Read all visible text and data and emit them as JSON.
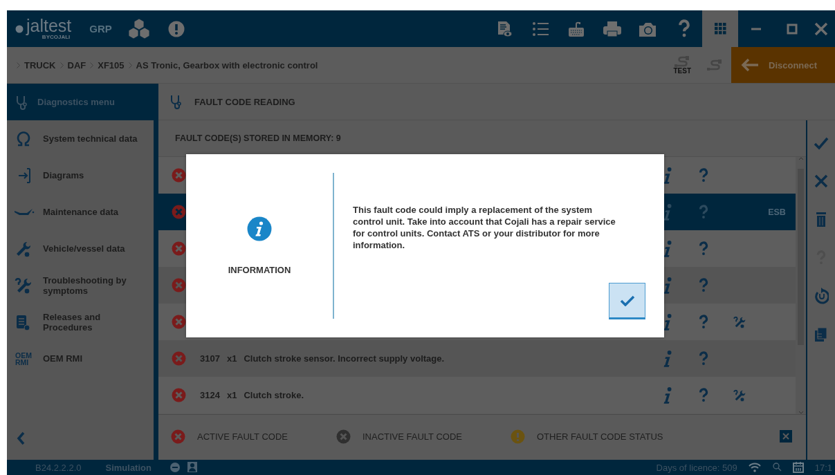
{
  "top_bar": {
    "logo": "**jal**test",
    "logo_sub": "BYCOJALI",
    "mode": "GRP"
  },
  "breadcrumb": [
    {
      "label": "TRUCK"
    },
    {
      "label": "DAF"
    },
    {
      "label": "XF105"
    },
    {
      "label": "AS Tronic, Gearbox with electronic control"
    }
  ],
  "connection": {
    "test_label": "TEST",
    "disconnect": "Disconnect"
  },
  "sidebar": {
    "title": "Diagnostics menu",
    "items": [
      {
        "kind": "omega",
        "label": "System technical data"
      },
      {
        "kind": "diagram",
        "label": "Diagrams"
      },
      {
        "kind": "oilcan",
        "label": "Maintenance data"
      },
      {
        "kind": "wrench",
        "label": "Vehicle/vessel data"
      },
      {
        "kind": "troubleshoot",
        "label": "Troubleshooting by symptoms"
      },
      {
        "kind": "document",
        "label": "Releases and Procedures"
      },
      {
        "kind": "oem",
        "icon_text": "OEM RMI",
        "label": "OEM RMI"
      }
    ]
  },
  "panel": {
    "title": "FAULT CODE READING",
    "count": "FAULT CODE(S) STORED IN MEMORY: 9",
    "rows": [
      {
        "kind": "active",
        "selected": false,
        "troubleshooting": false
      },
      {
        "kind": "active",
        "selected": true,
        "troubleshooting": false,
        "tag": "ESB"
      },
      {
        "kind": "active",
        "selected": false,
        "troubleshooting": false
      },
      {
        "kind": "active",
        "selected": false,
        "troubleshooting": false
      },
      {
        "kind": "active",
        "selected": false,
        "troubleshooting": true
      },
      {
        "kind": "active",
        "selected": false,
        "troubleshooting": false,
        "code": "3107",
        "count": "x1",
        "description": "Clutch stroke sensor. Incorrect supply voltage."
      },
      {
        "kind": "active",
        "selected": false,
        "troubleshooting": true,
        "code": "3124",
        "count": "x1",
        "description": "Clutch stroke."
      }
    ],
    "legend": [
      {
        "kind": "active",
        "label": "ACTIVE FAULT CODE"
      },
      {
        "kind": "inactive",
        "label": "INACTIVE FAULT CODE"
      },
      {
        "kind": "other",
        "label": "OTHER FAULT CODE STATUS"
      }
    ]
  },
  "dialog": {
    "title": "INFORMATION",
    "message": "This fault code could imply a replacement of the system control unit. Take into account that Cojali has a repair service for control units. Contact ATS or your distributor for more information."
  },
  "status_bar": {
    "version": "B24.2.2.2.0",
    "mode": "Simulation",
    "licence": "Days of licence: 509",
    "time": "17:1"
  }
}
